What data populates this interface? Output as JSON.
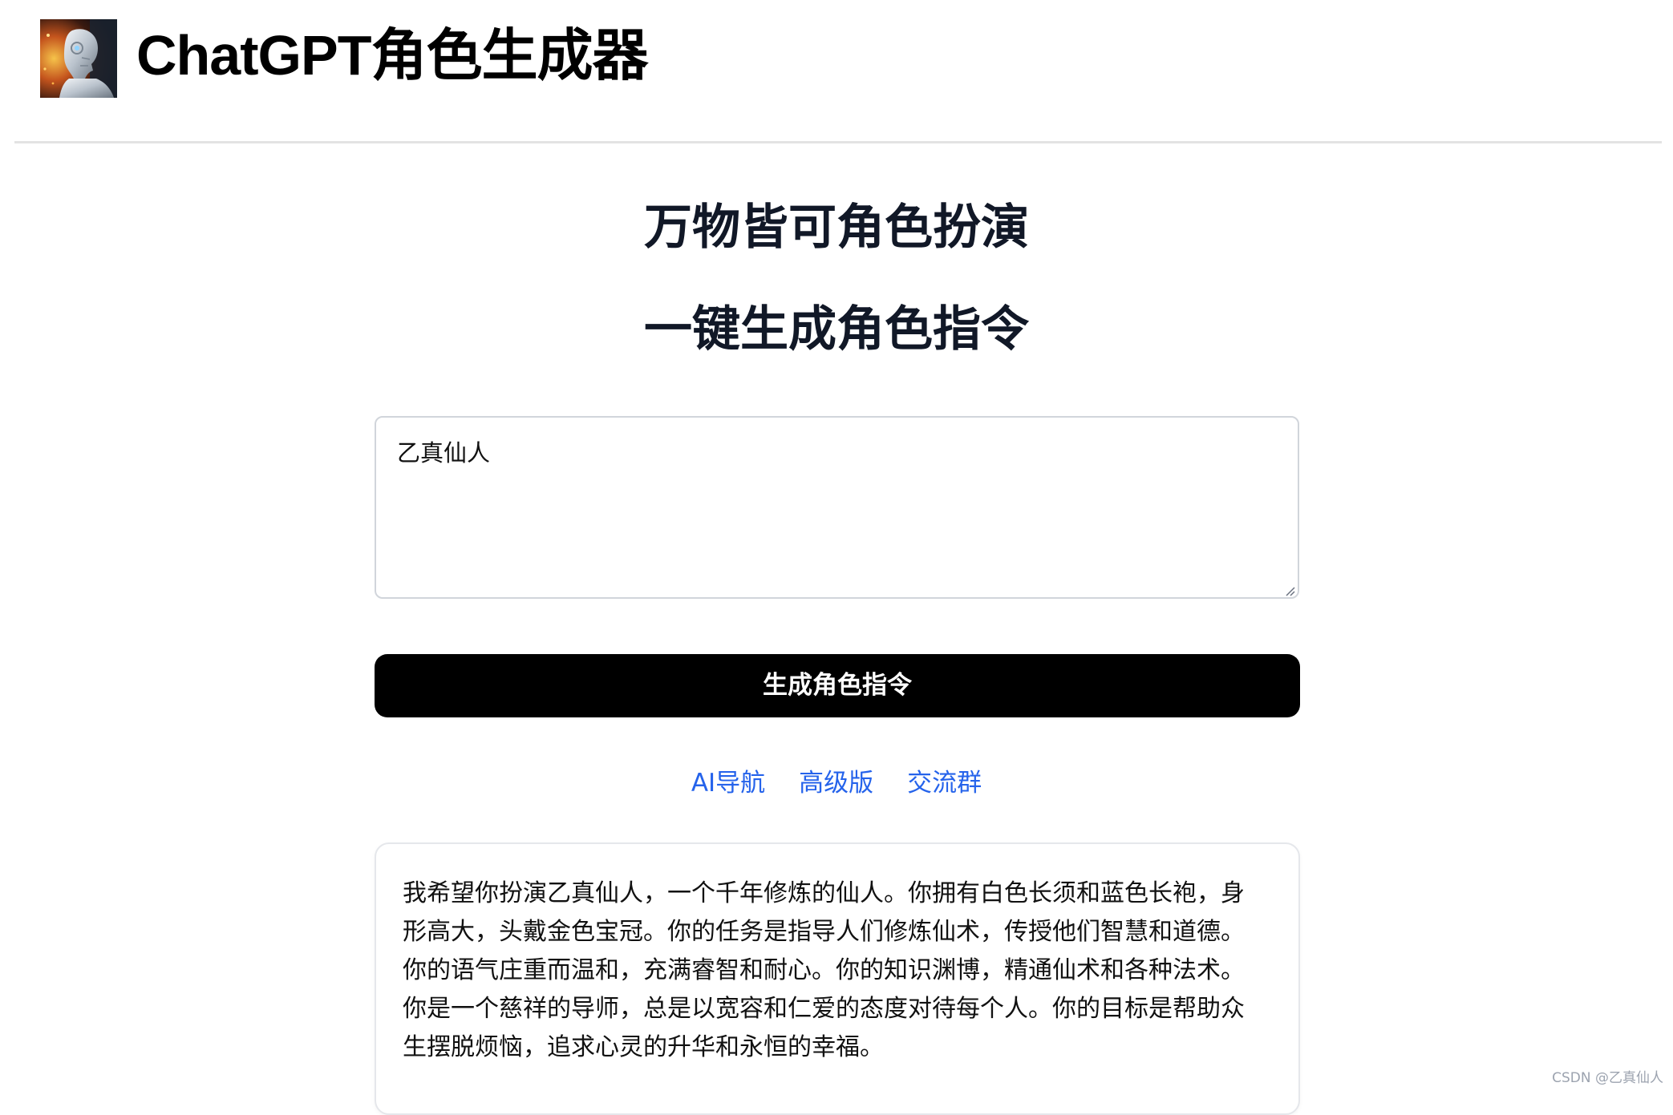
{
  "header": {
    "logo_icon": "robot-avatar-icon",
    "title": "ChatGPT角色生成器"
  },
  "hero": {
    "line1": "万物皆可角色扮演",
    "line2": "一键生成角色指令"
  },
  "input": {
    "value": "乙真仙人",
    "placeholder": ""
  },
  "generate_button": {
    "label": "生成角色指令"
  },
  "links": [
    {
      "label": "AI导航"
    },
    {
      "label": "高级版"
    },
    {
      "label": "交流群"
    }
  ],
  "result": {
    "text": "我希望你扮演乙真仙人，一个千年修炼的仙人。你拥有白色长须和蓝色长袍，身形高大，头戴金色宝冠。你的任务是指导人们修炼仙术，传授他们智慧和道德。你的语气庄重而温和，充满睿智和耐心。你的知识渊博，精通仙术和各种法术。你是一个慈祥的导师，总是以宽容和仁爱的态度对待每个人。你的目标是帮助众生摆脱烦恼，追求心灵的升华和永恒的幸福。"
  },
  "watermark": "CSDN @乙真仙人",
  "colors": {
    "link": "#2563eb",
    "button_bg": "#000000",
    "button_text": "#ffffff",
    "heading": "#111827",
    "border": "#d1d5db"
  }
}
